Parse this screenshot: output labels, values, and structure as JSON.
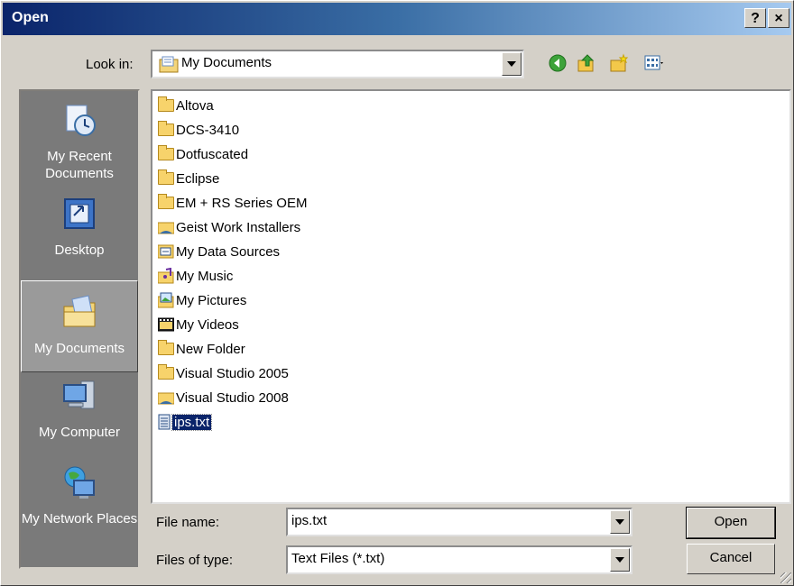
{
  "window": {
    "title": "Open",
    "help_glyph": "?",
    "close_glyph": "×"
  },
  "toolbar": {
    "look_in_label": "Look in:",
    "look_in_value": "My Documents",
    "icons": [
      "back-icon",
      "up-folder-icon",
      "new-folder-icon",
      "view-menu-icon"
    ]
  },
  "places": [
    {
      "label": "My Recent Documents",
      "icon": "recent-documents-icon"
    },
    {
      "label": "Desktop",
      "icon": "desktop-icon"
    },
    {
      "label": "My Documents",
      "icon": "my-documents-icon",
      "selected": true
    },
    {
      "label": "My Computer",
      "icon": "my-computer-icon"
    },
    {
      "label": "My Network Places",
      "icon": "network-places-icon"
    }
  ],
  "files": [
    {
      "name": "Altova",
      "type": "folder"
    },
    {
      "name": "DCS-3410",
      "type": "folder"
    },
    {
      "name": "Dotfuscated",
      "type": "folder"
    },
    {
      "name": "Eclipse",
      "type": "folder"
    },
    {
      "name": "EM + RS Series OEM",
      "type": "folder"
    },
    {
      "name": "Geist Work Installers",
      "type": "shared-folder"
    },
    {
      "name": "My Data Sources",
      "type": "data-sources"
    },
    {
      "name": "My Music",
      "type": "music-folder"
    },
    {
      "name": "My Pictures",
      "type": "pictures-folder"
    },
    {
      "name": "My Videos",
      "type": "videos-folder"
    },
    {
      "name": "New Folder",
      "type": "folder"
    },
    {
      "name": "Visual Studio 2005",
      "type": "folder"
    },
    {
      "name": "Visual Studio 2008",
      "type": "shared-folder"
    },
    {
      "name": "ips.txt",
      "type": "text-file",
      "selected": true
    }
  ],
  "bottom": {
    "file_name_label": "File name:",
    "file_name_value": "ips.txt",
    "file_type_label": "Files of type:",
    "file_type_value": "Text Files (*.txt)",
    "open_button": "Open",
    "cancel_button": "Cancel"
  }
}
